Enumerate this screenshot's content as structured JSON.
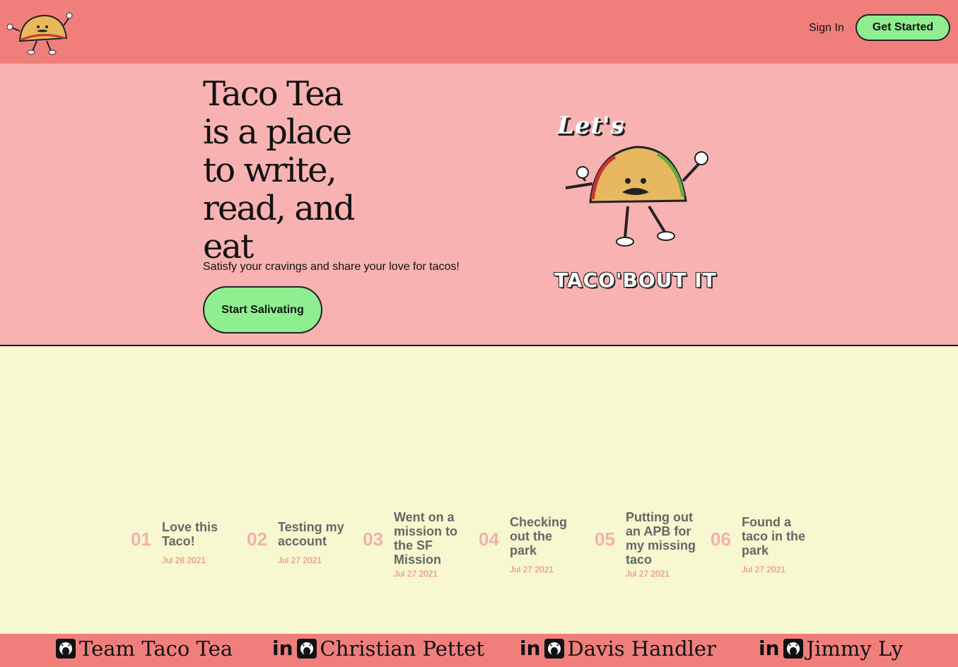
{
  "header": {
    "sign_in": "Sign In",
    "get_started": "Get Started"
  },
  "hero": {
    "title": "Taco Tea is a place to write, read, and eat",
    "subtitle": "Satisfy your cravings and share your love for tacos!",
    "cta": "Start Salivating",
    "graphic_top": "Let's",
    "graphic_bottom": "TACO'BOUT IT"
  },
  "posts": [
    {
      "num": "01",
      "title": "Love this Taco!",
      "date": "Jul 28 2021"
    },
    {
      "num": "02",
      "title": "Testing my account",
      "date": "Jul 27 2021"
    },
    {
      "num": "03",
      "title": "Went on a mission to the SF Mission",
      "date": "Jul 27 2021"
    },
    {
      "num": "04",
      "title": "Checking out the park",
      "date": "Jul 27 2021"
    },
    {
      "num": "05",
      "title": "Putting out an APB for my missing taco",
      "date": "Jul 27 2021"
    },
    {
      "num": "06",
      "title": "Found a taco in the park",
      "date": "Jul 27 2021"
    }
  ],
  "footer": {
    "items": [
      {
        "name": "Team Taco Tea",
        "icons": [
          "github-icon"
        ]
      },
      {
        "name": "Christian Pettet",
        "icons": [
          "linkedin-icon",
          "github-icon"
        ]
      },
      {
        "name": "Davis Handler",
        "icons": [
          "linkedin-icon",
          "github-icon"
        ]
      },
      {
        "name": "Jimmy Ly",
        "icons": [
          "linkedin-icon",
          "github-icon"
        ]
      }
    ]
  },
  "colors": {
    "header_bg": "#f07f7b",
    "hero_bg": "#f8b2b1",
    "page_bg": "#f8f8d0",
    "button_green": "#8fee8f",
    "post_number": "#f2b0ac",
    "post_date": "#ee7777"
  }
}
